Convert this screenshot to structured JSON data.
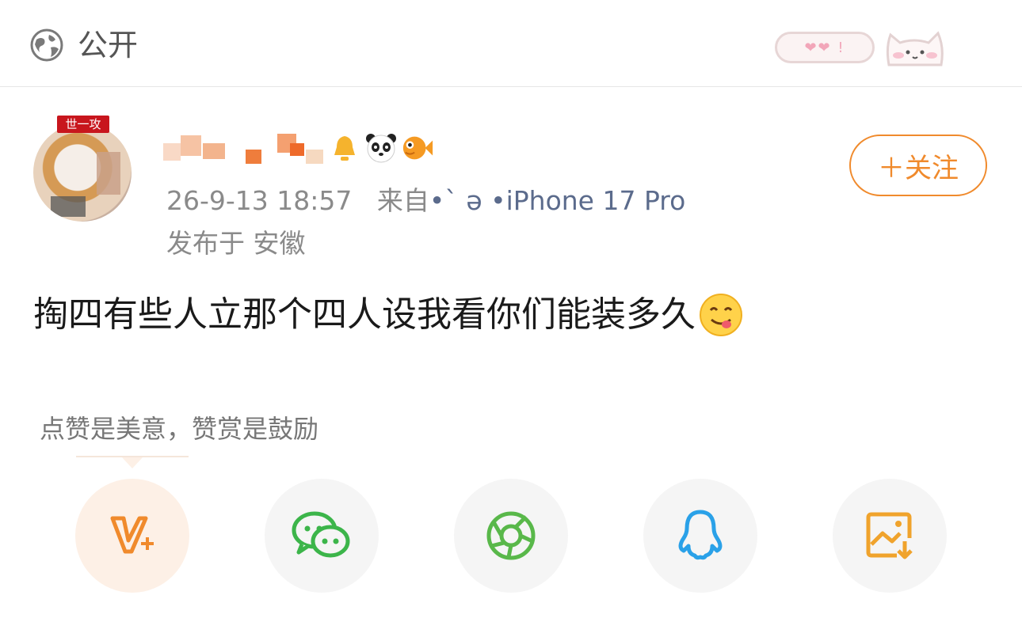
{
  "header": {
    "visibility_label": "公开",
    "globe_icon": "globe-icon",
    "sticker_text": "❤❤ !"
  },
  "post": {
    "avatar_badge": "世一攻",
    "time": "26-9-13 18:57",
    "source_prefix": "来自",
    "source_device": "•iPhone 17 Pro",
    "location": "发布于 安徽",
    "text": "掏四有些人立那个四人设我看你们能装多久",
    "follow_label": "＋关注"
  },
  "reward": {
    "tip_text": "点赞是美意，赞赏是鼓励"
  },
  "share": {
    "items": [
      "vip-reward-icon",
      "wechat-icon",
      "moments-icon",
      "qq-icon",
      "save-image-icon"
    ]
  },
  "colors": {
    "accent": "#f08a2c",
    "wechat": "#3cb54a",
    "moments": "#59b84a",
    "qq": "#2aa1e8",
    "save": "#f0a32c"
  }
}
